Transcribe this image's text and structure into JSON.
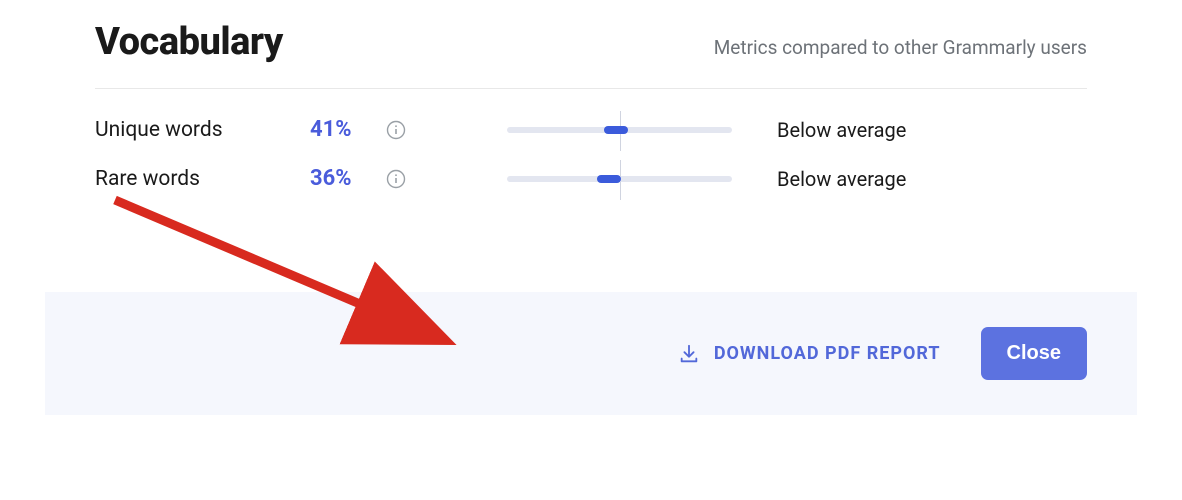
{
  "header": {
    "title": "Vocabulary",
    "subtitle": "Metrics compared to other Grammarly users"
  },
  "metrics": [
    {
      "label": "Unique words",
      "value": "41%",
      "marker_left_pct": 43,
      "assessment": "Below average"
    },
    {
      "label": "Rare words",
      "value": "36%",
      "marker_left_pct": 40,
      "assessment": "Below average"
    }
  ],
  "footer": {
    "download_label": "DOWNLOAD PDF REPORT",
    "close_label": "Close"
  },
  "colors": {
    "accent": "#4a5cdb",
    "button": "#5c72e0",
    "annotation": "#d82a1f"
  }
}
